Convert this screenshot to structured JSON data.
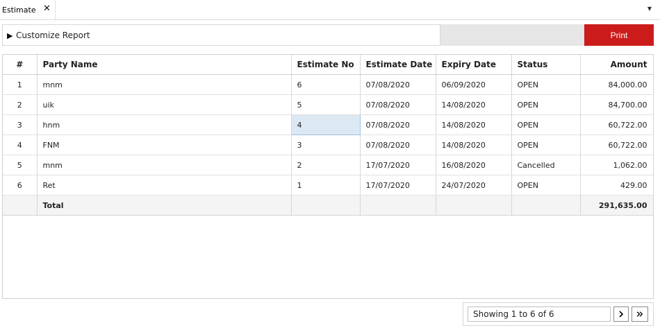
{
  "tabs": [
    {
      "label": "Estimate",
      "close_icon": "close-icon"
    }
  ],
  "toolbar": {
    "customize_label": "Customize Report",
    "print_label": "Print",
    "print_color": "#cc1b1b"
  },
  "table": {
    "columns": [
      "#",
      "Party Name",
      "Estimate No",
      "Estimate Date",
      "Expiry Date",
      "Status",
      "Amount"
    ],
    "rows": [
      {
        "num": "1",
        "party": "mnm",
        "estimate_no": "6",
        "estimate_date": "07/08/2020",
        "expiry_date": "06/09/2020",
        "status": "OPEN",
        "amount": "84,000.00"
      },
      {
        "num": "2",
        "party": "uik",
        "estimate_no": "5",
        "estimate_date": "07/08/2020",
        "expiry_date": "14/08/2020",
        "status": "OPEN",
        "amount": "84,700.00"
      },
      {
        "num": "3",
        "party": "hnm",
        "estimate_no": "4",
        "estimate_date": "07/08/2020",
        "expiry_date": "14/08/2020",
        "status": "OPEN",
        "amount": "60,722.00"
      },
      {
        "num": "4",
        "party": "FNM",
        "estimate_no": "3",
        "estimate_date": "07/08/2020",
        "expiry_date": "14/08/2020",
        "status": "OPEN",
        "amount": "60,722.00"
      },
      {
        "num": "5",
        "party": "mnm",
        "estimate_no": "2",
        "estimate_date": "17/07/2020",
        "expiry_date": "16/08/2020",
        "status": "Cancelled",
        "amount": "1,062.00"
      },
      {
        "num": "6",
        "party": "Ret",
        "estimate_no": "1",
        "estimate_date": "17/07/2020",
        "expiry_date": "24/07/2020",
        "status": "OPEN",
        "amount": "429.00"
      }
    ],
    "total_label": "Total",
    "total_amount": "291,635.00"
  },
  "pager": {
    "status": "Showing 1 to 6 of 6"
  }
}
